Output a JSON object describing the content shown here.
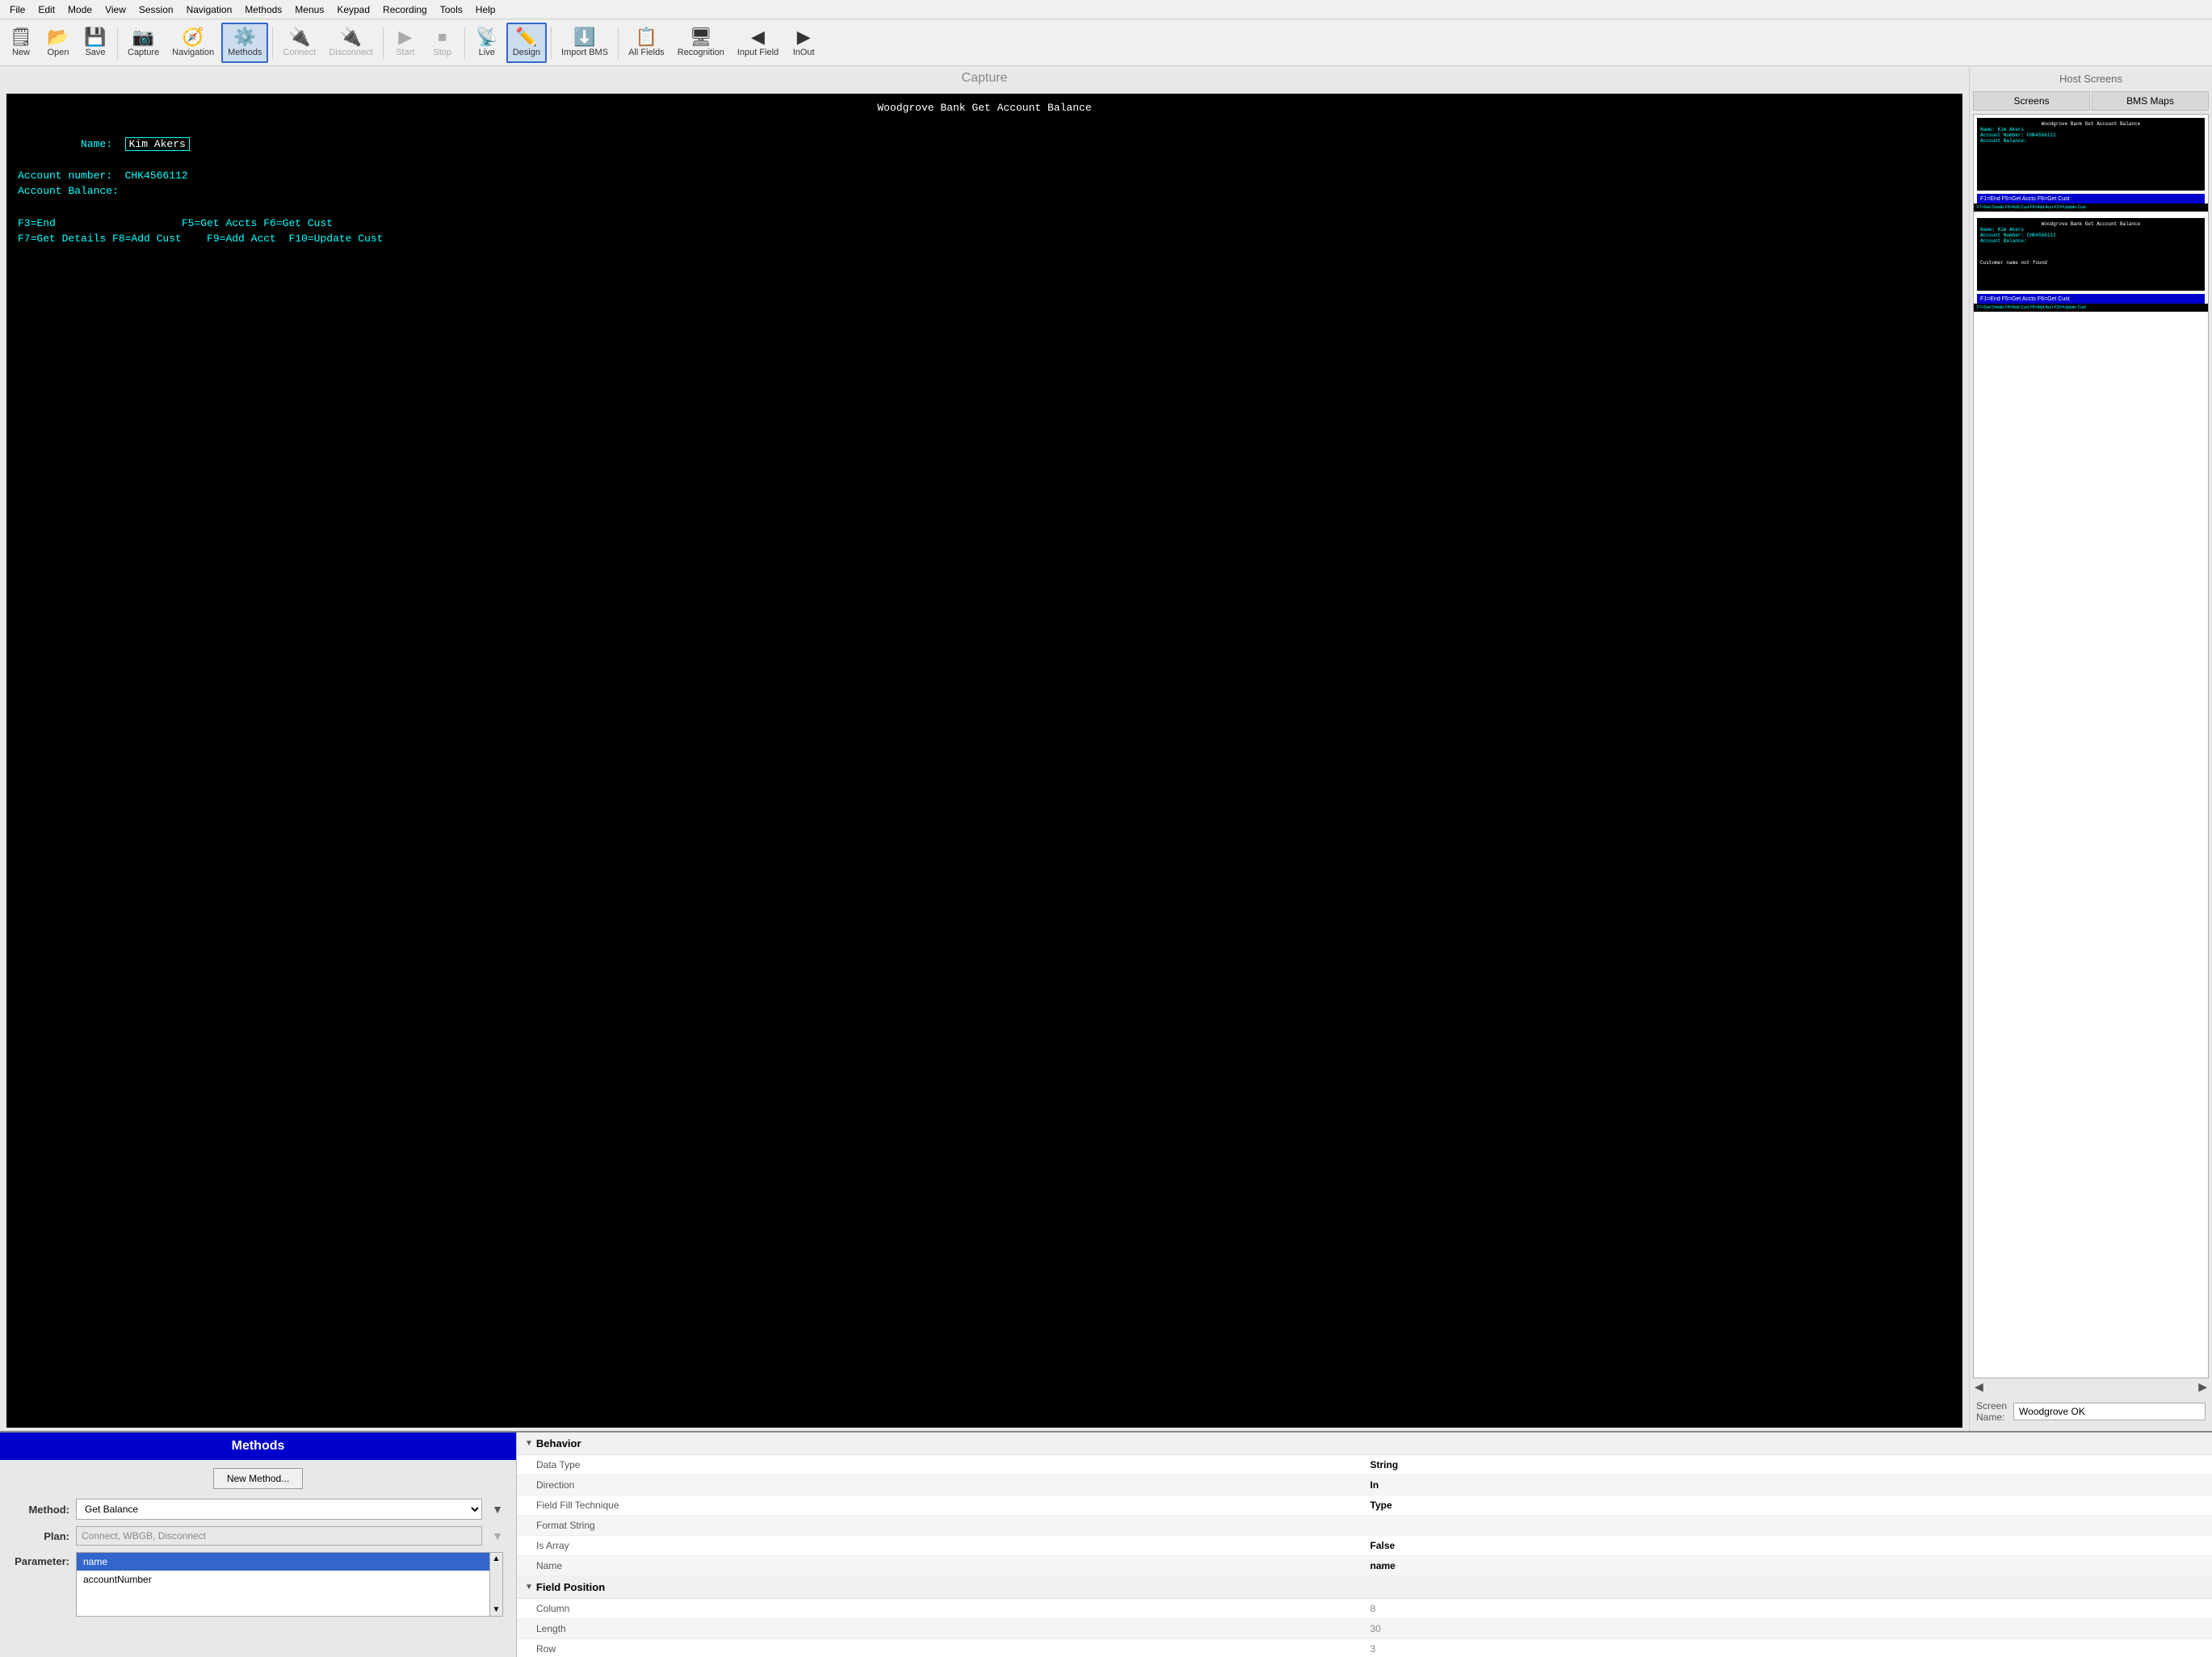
{
  "menubar": {
    "items": [
      "File",
      "Edit",
      "Mode",
      "View",
      "Session",
      "Navigation",
      "Methods",
      "Menus",
      "Keypad",
      "Recording",
      "Tools",
      "Help"
    ]
  },
  "toolbar": {
    "buttons": [
      {
        "label": "New",
        "icon": "🗒",
        "active": false
      },
      {
        "label": "Open",
        "icon": "📂",
        "active": false
      },
      {
        "label": "Save",
        "icon": "💾",
        "active": false
      },
      {
        "label": "Capture",
        "icon": "📷",
        "active": false
      },
      {
        "label": "Navigation",
        "icon": "🧭",
        "active": false
      },
      {
        "label": "Methods",
        "icon": "⚙️",
        "active": true
      },
      {
        "label": "Connect",
        "icon": "🔌",
        "active": false
      },
      {
        "label": "Disconnect",
        "icon": "🔌",
        "active": false
      },
      {
        "label": "Start",
        "icon": "▶",
        "active": false
      },
      {
        "label": "Stop",
        "icon": "⏹",
        "active": false
      },
      {
        "label": "Live",
        "icon": "📡",
        "active": false
      },
      {
        "label": "Design",
        "icon": "✏️",
        "active": true
      },
      {
        "label": "Import BMS",
        "icon": "⬇️",
        "active": false
      },
      {
        "label": "All Fields",
        "icon": "📋",
        "active": false
      },
      {
        "label": "Recognition",
        "icon": "🖥",
        "active": false
      },
      {
        "label": "Input Field",
        "icon": "◀",
        "active": false
      },
      {
        "label": "InOut",
        "icon": "▶",
        "active": false
      }
    ]
  },
  "capture": {
    "title": "Capture",
    "terminal": {
      "title": "Woodgrove Bank Get Account Balance",
      "lines": [
        {
          "type": "field",
          "label": "Name:",
          "value": "Kim Akers"
        },
        {
          "type": "text",
          "content": "Account number:  CHK4566112"
        },
        {
          "type": "text",
          "content": "Account Balance:"
        }
      ],
      "footer": [
        "F3=End                    F5=Get Accts F6=Get Cust",
        "F7=Get Details F8=Add Cust    F9=Add Acct  F10=Update Cust"
      ]
    }
  },
  "host_screens": {
    "title": "Host Screens",
    "tabs": [
      "Screens",
      "BMS Maps"
    ],
    "screen_name_label": "Screen\nName:",
    "screen_name_value": "Woodgrove OK",
    "mini_screens": [
      {
        "lines": [
          "Name:  Kim Akers",
          "Account Number: CHK4566112",
          "Account Balance:"
        ],
        "divider": "F1=End              F5=Get Accts F6=Get Cust",
        "sub": "F7=Get Details F8=Add Cust    F9=Add Acct  F10=Update Cust"
      },
      {
        "title": "Woodgrove Bank Get Account Balance",
        "lines": [
          "Name:  Kim Akers",
          "Account Number: CHK4566112",
          "Account Balance:"
        ],
        "divider": "Customer name not found",
        "sub": "F1=End              F5=Get Accts F6=Get Cust"
      }
    ]
  },
  "methods": {
    "title": "Methods",
    "new_method_btn": "New Method...",
    "method_label": "Method:",
    "method_value": "Get Balance",
    "plan_label": "Plan:",
    "plan_value": "Connect, WBGB, Disconnect",
    "parameter_label": "Parameter:",
    "parameters": [
      {
        "label": "name",
        "selected": true
      },
      {
        "label": "accountNumber",
        "selected": false
      }
    ]
  },
  "properties": {
    "behavior_section": "Behavior",
    "field_position_section": "Field Position",
    "rows": [
      {
        "name": "Data Type",
        "value": "String",
        "bold": true,
        "shaded": false
      },
      {
        "name": "Direction",
        "value": "In",
        "bold": true,
        "shaded": true
      },
      {
        "name": "Field Fill Technique",
        "value": "Type",
        "bold": true,
        "shaded": false
      },
      {
        "name": "Format String",
        "value": "",
        "bold": false,
        "shaded": true
      },
      {
        "name": "Is Array",
        "value": "False",
        "bold": true,
        "shaded": false
      },
      {
        "name": "Name",
        "value": "name",
        "bold": true,
        "shaded": true
      }
    ],
    "position_rows": [
      {
        "name": "Column",
        "value": "8",
        "bold": false,
        "shaded": false
      },
      {
        "name": "Length",
        "value": "30",
        "bold": false,
        "shaded": true
      },
      {
        "name": "Row",
        "value": "3",
        "bold": false,
        "shaded": false
      }
    ]
  }
}
